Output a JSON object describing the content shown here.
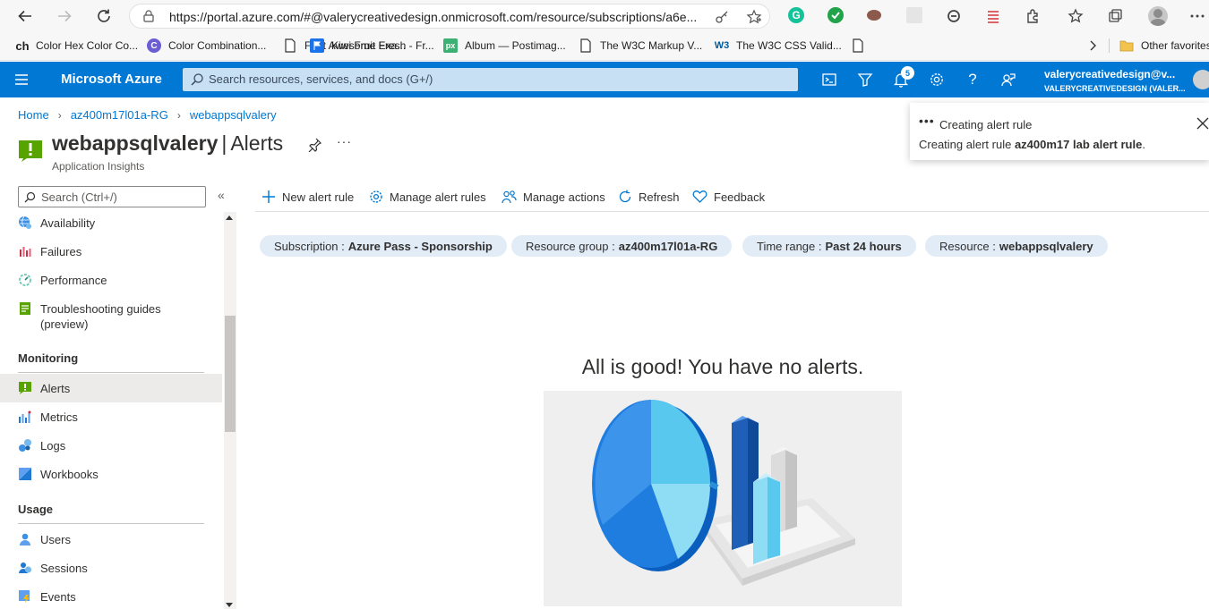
{
  "browser": {
    "url": "https://portal.azure.com/#@valerycreativedesign.onmicrosoft.com/resource/subscriptions/a6e...",
    "bookmarks": [
      {
        "label": "Color Hex Color Co...",
        "icon": "ch"
      },
      {
        "label": "Color Combination...",
        "icon": "C"
      },
      {
        "label": "Font Awesome Exa...",
        "icon": "doc"
      },
      {
        "label": "Kiwi Fruit Fresh - Fr...",
        "icon": "flag"
      },
      {
        "label": "Album — Postimag...",
        "icon": "px"
      },
      {
        "label": "The W3C Markup V...",
        "icon": "doc"
      },
      {
        "label": "The W3C CSS Valid...",
        "icon": "W3"
      },
      {
        "label": "",
        "icon": "doc"
      }
    ],
    "other_favorites": "Other favorites",
    "colors": {
      "chrome_bg": "#f7f7f7",
      "grammarly": "#15c39a",
      "check": "#20a34a"
    }
  },
  "azure": {
    "brand": "Microsoft Azure",
    "search_placeholder": "Search resources, services, and docs (G+/)",
    "notification_count": "5",
    "account_name": "valerycreativedesign@v...",
    "account_tenant": "VALERYCREATIVEDESIGN (VALER...",
    "accent": "#0078d4",
    "topbar_icons": [
      "cloud-shell-icon",
      "directory-filter-icon",
      "notifications-icon",
      "settings-icon",
      "help-icon",
      "feedback-icon"
    ]
  },
  "breadcrumb": [
    "Home",
    "az400m17l01a-RG",
    "webappsqlvalery"
  ],
  "resource": {
    "name": "webappsqlvalery",
    "separator": "|",
    "blade": "Alerts",
    "type": "Application Insights",
    "more": "···"
  },
  "sidebar": {
    "search_placeholder": "Search (Ctrl+/)",
    "collapse": "«",
    "items_top": [
      {
        "label": "Availability",
        "icon": "availability-icon"
      },
      {
        "label": "Failures",
        "icon": "failures-icon"
      },
      {
        "label": "Performance",
        "icon": "performance-icon"
      },
      {
        "label": "Troubleshooting guides (preview)",
        "icon": "troubleshooting-icon"
      }
    ],
    "monitoring_heading": "Monitoring",
    "monitoring_items": [
      {
        "label": "Alerts",
        "icon": "alerts-icon",
        "active": true
      },
      {
        "label": "Metrics",
        "icon": "metrics-icon"
      },
      {
        "label": "Logs",
        "icon": "logs-icon"
      },
      {
        "label": "Workbooks",
        "icon": "workbooks-icon"
      }
    ],
    "usage_heading": "Usage",
    "usage_items": [
      {
        "label": "Users",
        "icon": "users-icon"
      },
      {
        "label": "Sessions",
        "icon": "sessions-icon"
      },
      {
        "label": "Events",
        "icon": "events-icon"
      }
    ]
  },
  "commands": {
    "new_alert_rule": "New alert rule",
    "manage_alert_rules": "Manage alert rules",
    "manage_actions": "Manage actions",
    "refresh": "Refresh",
    "feedback": "Feedback"
  },
  "filters": [
    {
      "key": "Subscription :",
      "value": "Azure Pass - Sponsorship"
    },
    {
      "key": "Resource group :",
      "value": "az400m17l01a-RG"
    },
    {
      "key": "Time range :",
      "value": "Past 24 hours"
    },
    {
      "key": "Resource :",
      "value": "webappsqlvalery"
    }
  ],
  "empty_state": {
    "title": "All is good! You have no alerts."
  },
  "toast": {
    "dots": "•••",
    "title": "Creating alert rule",
    "body_prefix": "Creating alert rule ",
    "body_rule": "az400m17 lab alert rule",
    "body_suffix": "."
  }
}
